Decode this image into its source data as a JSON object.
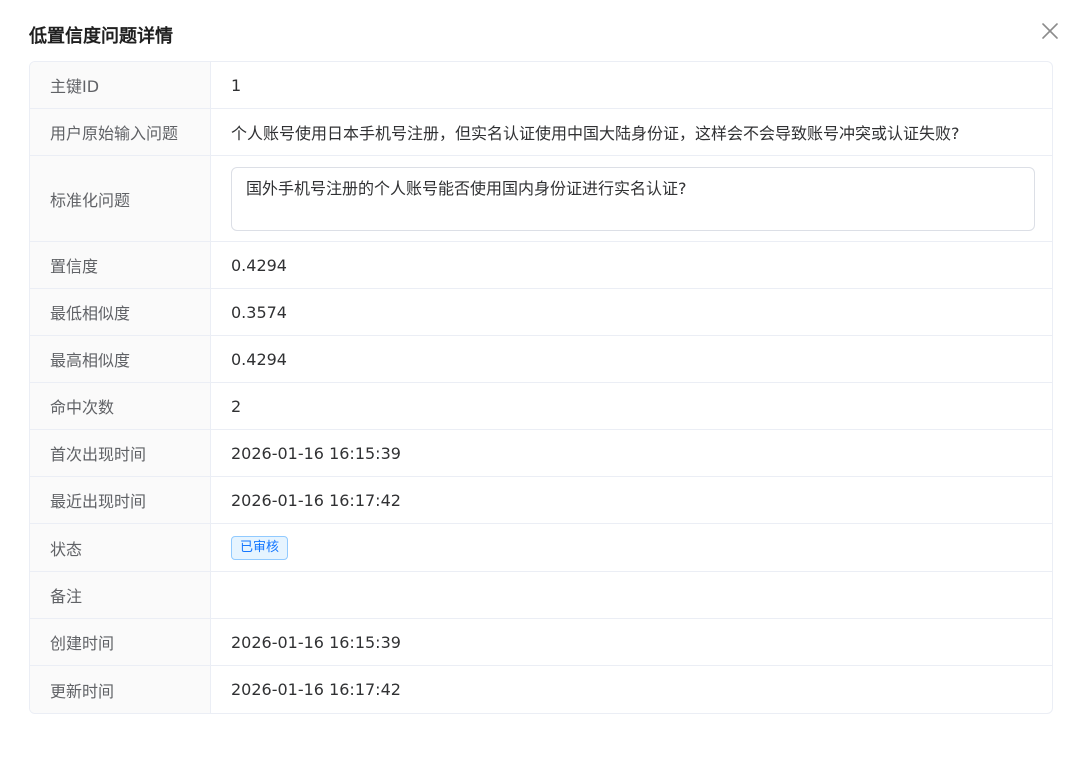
{
  "dialog": {
    "title": "低置信度问题详情",
    "close_icon": "close-icon"
  },
  "fields": {
    "id": {
      "label": "主键ID",
      "value": "1"
    },
    "raw_question": {
      "label": "用户原始输入问题",
      "value": "个人账号使用日本手机号注册，但实名认证使用中国大陆身份证，这样会不会导致账号冲突或认证失败?"
    },
    "normalized_question": {
      "label": "标准化问题",
      "value": "国外手机号注册的个人账号能否使用国内身份证进行实名认证?"
    },
    "confidence": {
      "label": "置信度",
      "value": "0.4294"
    },
    "min_similarity": {
      "label": "最低相似度",
      "value": "0.3574"
    },
    "max_similarity": {
      "label": "最高相似度",
      "value": "0.4294"
    },
    "hit_count": {
      "label": "命中次数",
      "value": "2"
    },
    "first_seen": {
      "label": "首次出现时间",
      "value": "2026-01-16 16:15:39"
    },
    "last_seen": {
      "label": "最近出现时间",
      "value": "2026-01-16 16:17:42"
    },
    "status": {
      "label": "状态",
      "value": "已审核",
      "color": "#1677ff"
    },
    "remark": {
      "label": "备注",
      "value": ""
    },
    "created_at": {
      "label": "创建时间",
      "value": "2026-01-16 16:15:39"
    },
    "updated_at": {
      "label": "更新时间",
      "value": "2026-01-16 16:17:42"
    }
  }
}
